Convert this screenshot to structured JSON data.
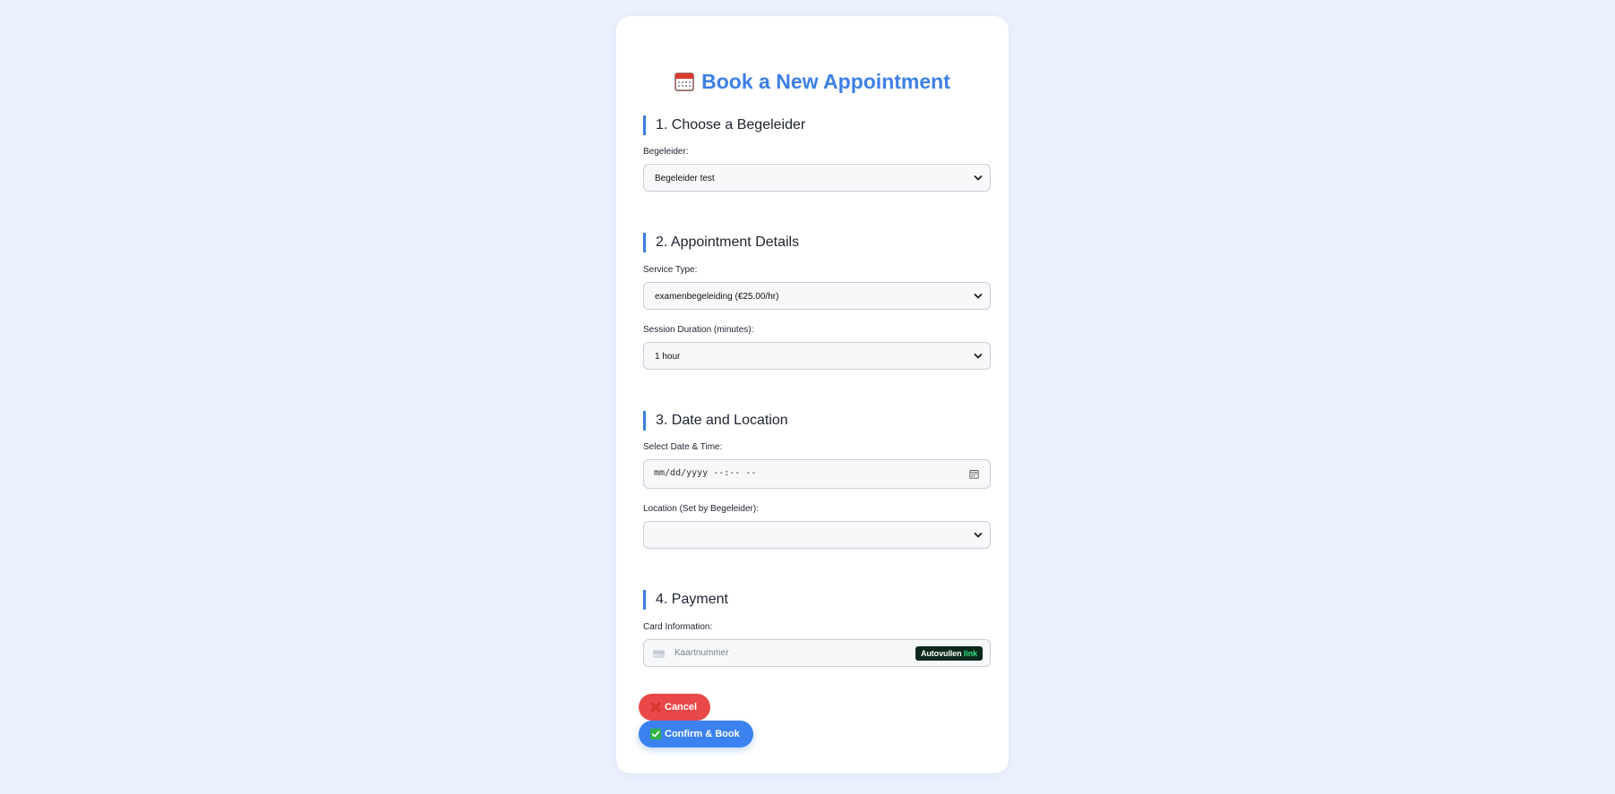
{
  "page": {
    "title": "Book a New Appointment",
    "title_icon": "calendar-icon"
  },
  "sections": {
    "begeleider": {
      "heading": "1. Choose a Begeleider",
      "label": "Begeleider:",
      "selected": "Begeleider test"
    },
    "details": {
      "heading": "2. Appointment Details",
      "service_label": "Service Type:",
      "service_selected": "examenbegeleiding (€25.00/hr)",
      "duration_label": "Session Duration (minutes):",
      "duration_selected": "1 hour"
    },
    "date_location": {
      "heading": "3. Date and Location",
      "datetime_label": "Select Date & Time:",
      "datetime_placeholder": "mm/dd/yyyy --:-- --",
      "location_label": "Location (Set by Begeleider):",
      "location_selected": ""
    },
    "payment": {
      "heading": "4. Payment",
      "card_label": "Card Information:",
      "card_placeholder": "Kaartnummer",
      "autofill_text": "Autovullen",
      "autofill_link": "link"
    }
  },
  "actions": {
    "cancel_label": "Cancel",
    "confirm_label": "Confirm & Book"
  },
  "colors": {
    "accent": "#3e7fe6",
    "cancel": "#ea4848",
    "confirm": "#3b82f0",
    "background": "#ebf0fe"
  }
}
